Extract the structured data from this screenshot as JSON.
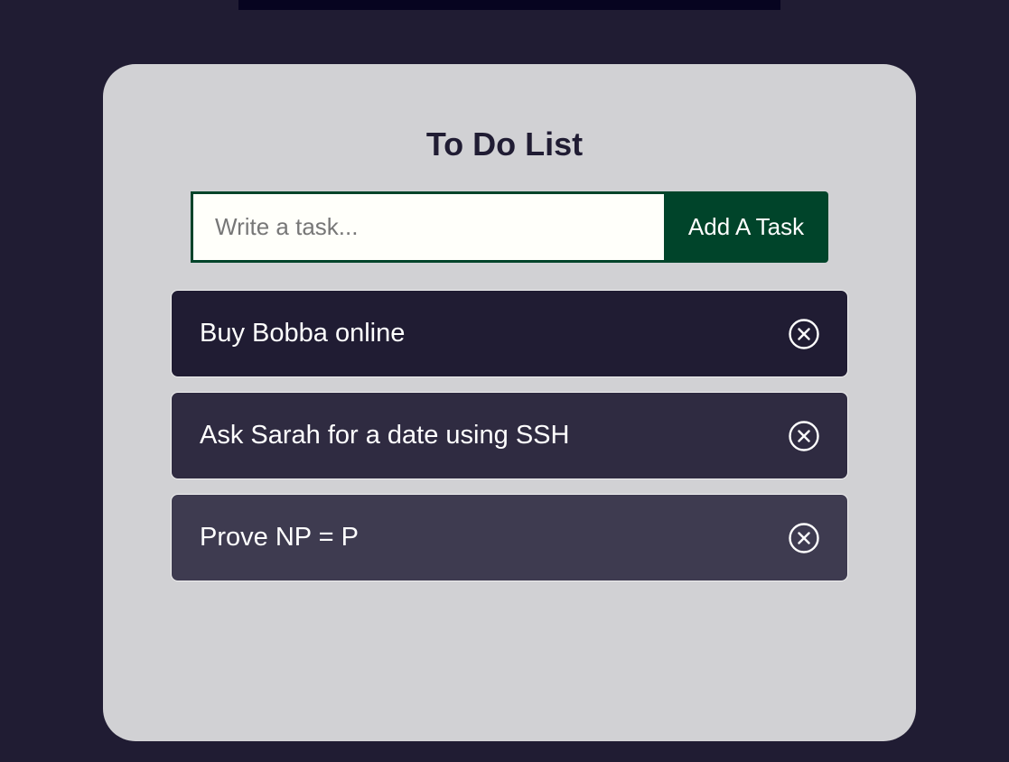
{
  "app": {
    "title": "To Do List"
  },
  "add_form": {
    "input_value": "",
    "input_placeholder": "Write a task...",
    "button_label": "Add A Task"
  },
  "tasks": [
    {
      "label": "Buy Bobba online",
      "remove_icon": "close-circle-icon"
    },
    {
      "label": "Ask Sarah for a date using SSH",
      "remove_icon": "close-circle-icon"
    },
    {
      "label": "Prove NP = P",
      "remove_icon": "close-circle-icon"
    }
  ],
  "colors": {
    "page_background": "#201c33",
    "card_background": "#d1d1d4",
    "accent_green": "#00442a",
    "task_shades": [
      "#201c33",
      "#2f2b41",
      "#3e3b50"
    ]
  }
}
